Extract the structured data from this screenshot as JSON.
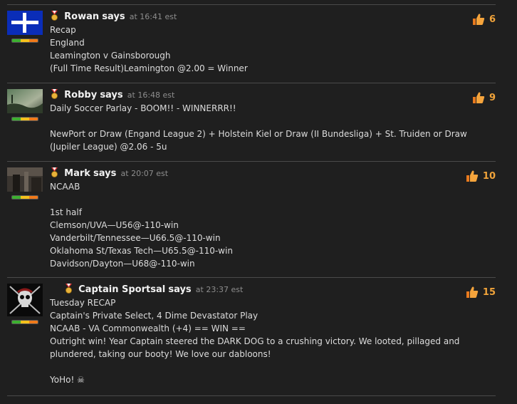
{
  "comments": [
    {
      "author": "Rowan",
      "says": "says",
      "time": "at 16:41 est",
      "likes": "6",
      "avatar": "flag-avatar",
      "lines": [
        "Recap",
        "England",
        "Leamington v Gainsborough",
        "(Full Time Result)Leamington @2.00 = Winner"
      ]
    },
    {
      "author": "Robby",
      "says": "says",
      "time": "at 16:48 est",
      "likes": "9",
      "avatar": "photo-avatar",
      "lines": [
        "Daily Soccer Parlay - BOOM!! - WINNERRR!!",
        "",
        "NewPort or Draw (Engand League 2) + Holstein Kiel or Draw (II Bundesliga) + St. Truiden or Draw",
        "(Jupiler League) @2.06 - 5u"
      ]
    },
    {
      "author": "Mark",
      "says": "says",
      "time": "at 20:07 est",
      "likes": "10",
      "avatar": "photo-avatar",
      "lines": [
        "NCAAB",
        "",
        "1st half",
        "Clemson/UVA—U56@-110-win",
        "Vanderbilt/Tennessee—U66.5@-110-win",
        "Oklahoma St/Texas Tech—U65.5@-110-win",
        "Davidson/Dayton—U68@-110-win"
      ]
    },
    {
      "author": "Captain Sportsal",
      "says": "says",
      "time": "at 23:37 est",
      "likes": "15",
      "avatar": "skull-avatar",
      "lines": [
        "Tuesday RECAP",
        "Captain's Private Select, 4 Dime Devastator Play",
        "NCAAB - VA Commonwealth (+4) == WIN ==",
        "Outright win! Year Captain steered the DARK DOG to a crushing victory. We looted, pillaged and",
        "plundered, taking our booty! We love our dabloons!",
        "",
        "YoHo! ☠"
      ]
    }
  ],
  "colors": {
    "accent": "#f0a33a",
    "background": "#1f1f1f",
    "meta": "#8d8d8d"
  },
  "icons": {
    "like": "thumbs-up-icon",
    "medal": "medal-icon"
  }
}
